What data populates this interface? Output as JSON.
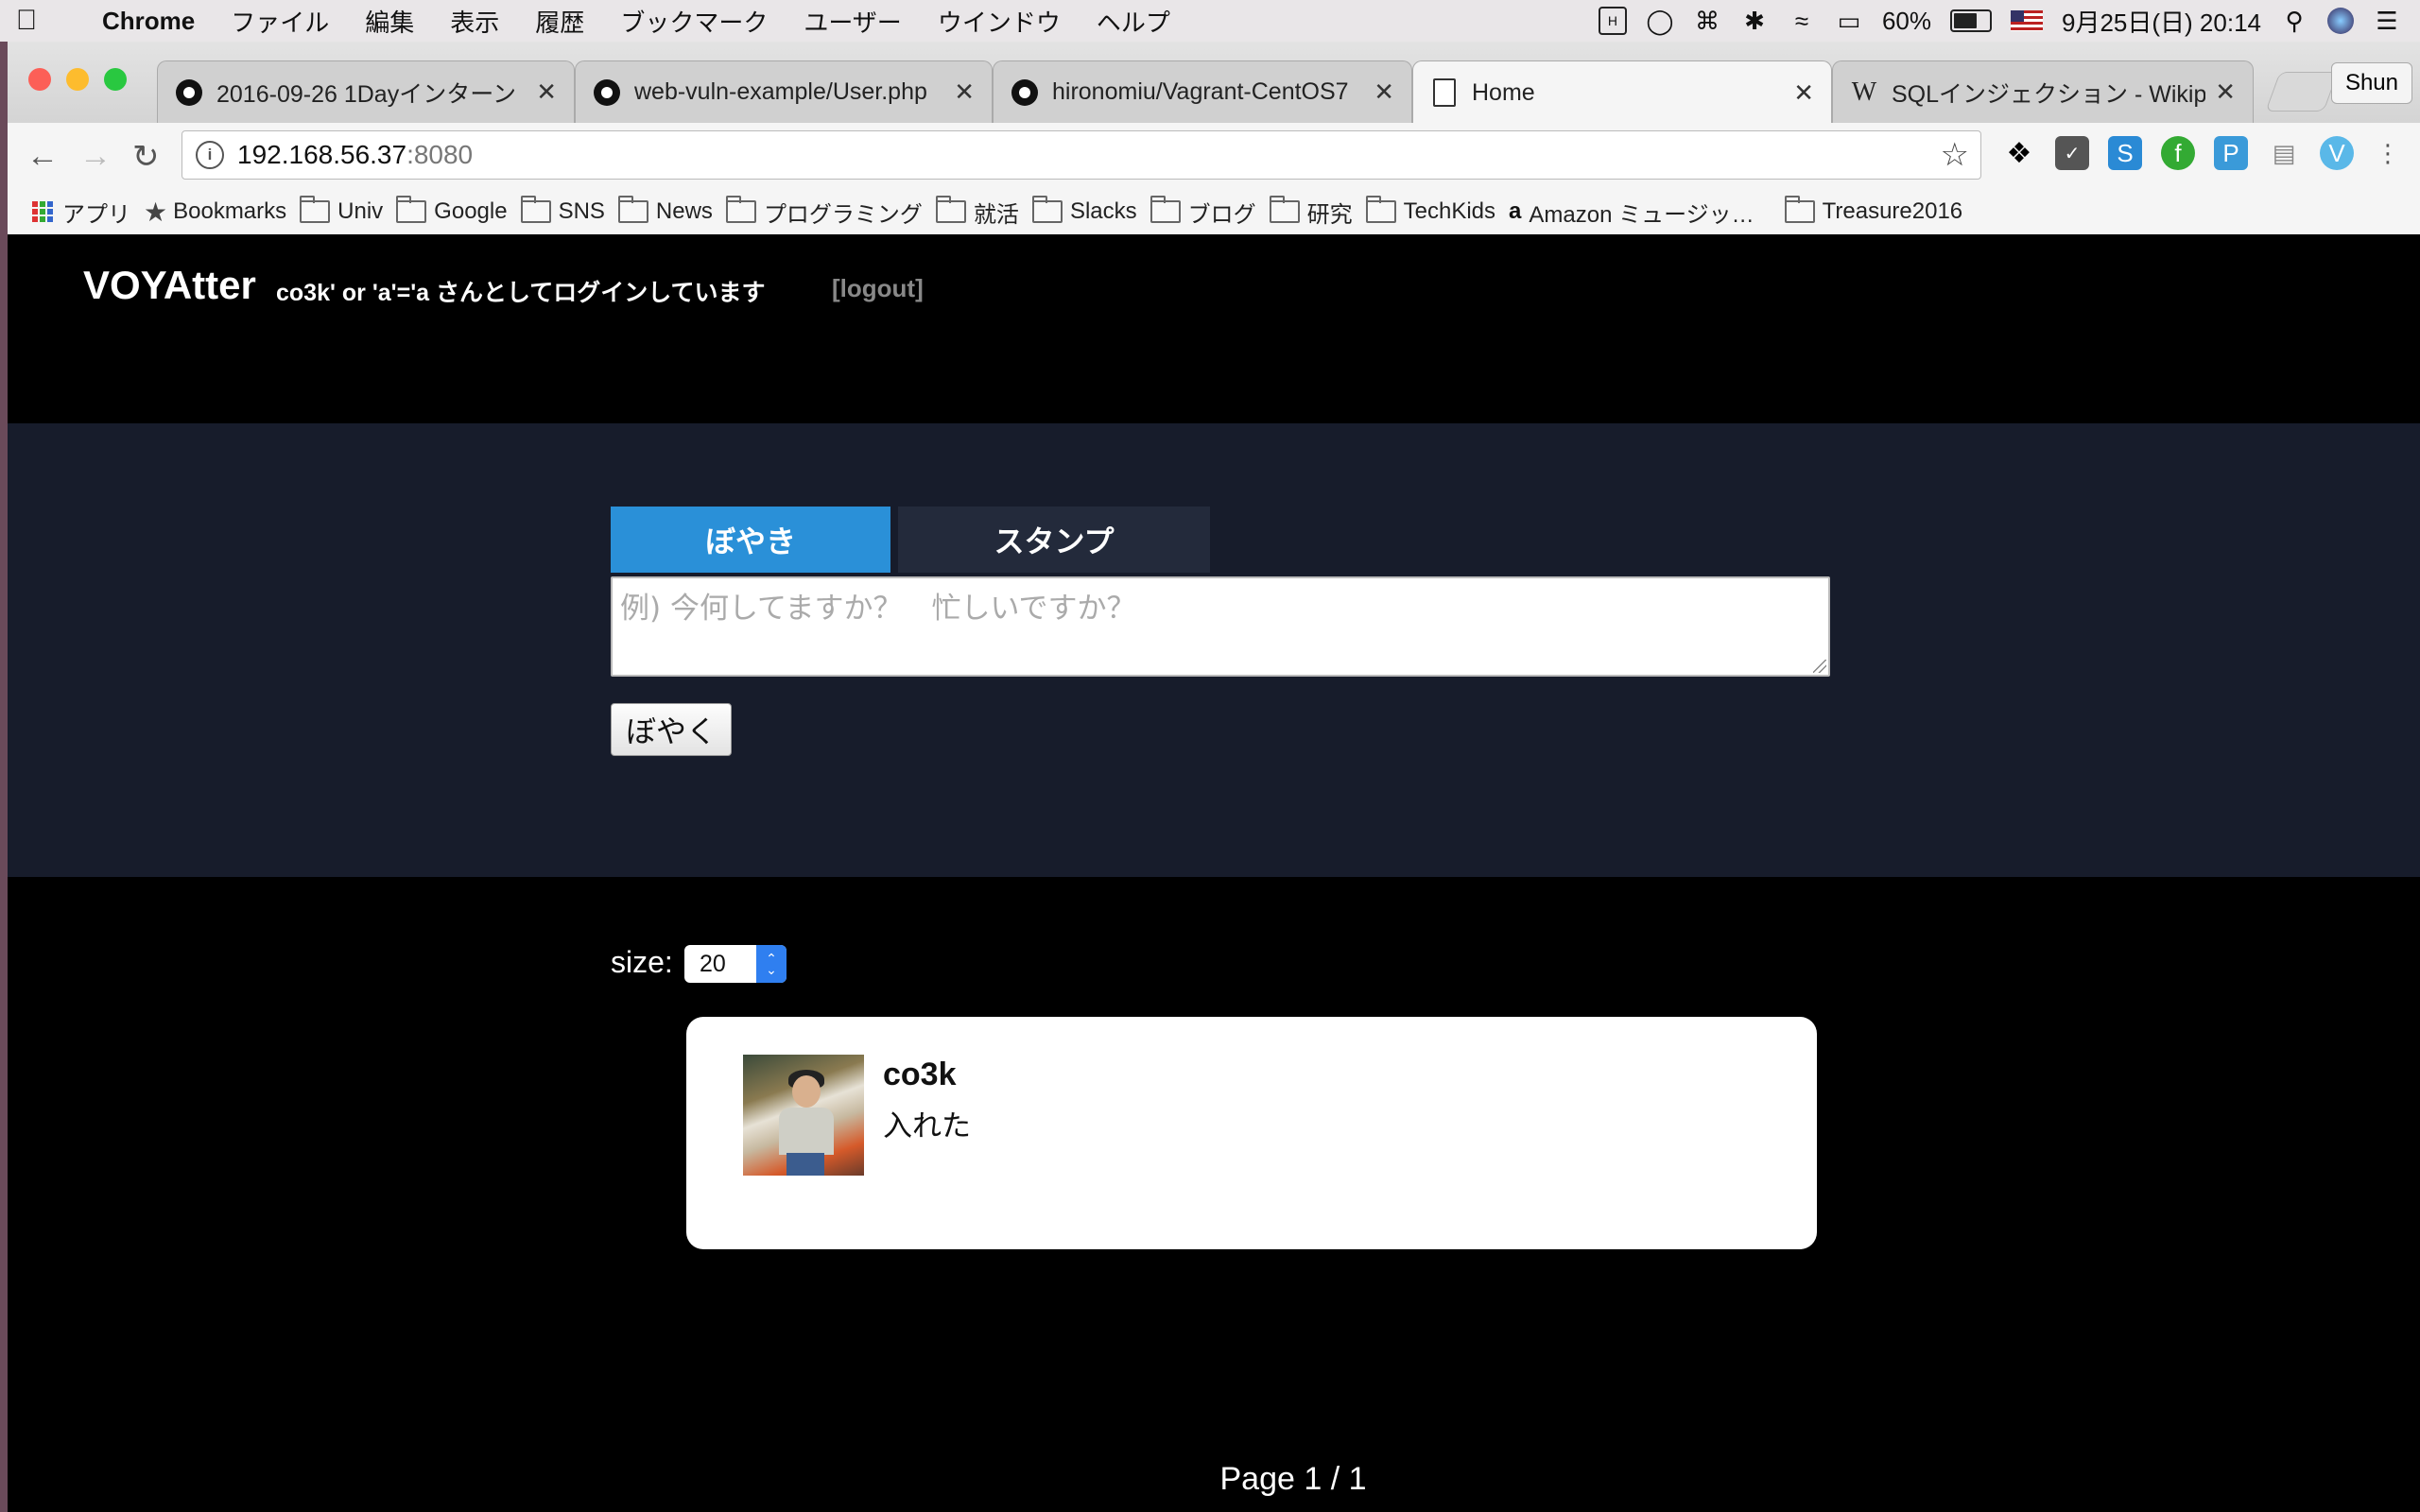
{
  "menubar": {
    "app_name": "Chrome",
    "menus": [
      "ファイル",
      "編集",
      "表示",
      "履歴",
      "ブックマーク",
      "ユーザー",
      "ウインドウ",
      "ヘルプ"
    ],
    "battery": "60%",
    "datetime": "9月25日(日)  20:14"
  },
  "tabs": [
    {
      "title": "2016-09-26 1Dayインターン",
      "icon": "github-icon"
    },
    {
      "title": "web-vuln-example/User.php",
      "icon": "github-icon"
    },
    {
      "title": "hironomiu/Vagrant-CentOS7",
      "icon": "github-icon"
    },
    {
      "title": "Home",
      "icon": "document-icon",
      "active": true
    },
    {
      "title": "SQLインジェクション - Wikipe",
      "icon": "wikipedia-icon"
    }
  ],
  "profile_name": "Shun",
  "address": {
    "host": "192.168.56.37",
    "port": ":8080"
  },
  "bookmarks": [
    {
      "label": "アプリ",
      "type": "apps"
    },
    {
      "label": "Bookmarks",
      "type": "star"
    },
    {
      "label": "Univ",
      "type": "folder"
    },
    {
      "label": "Google",
      "type": "folder"
    },
    {
      "label": "SNS",
      "type": "folder"
    },
    {
      "label": "News",
      "type": "folder"
    },
    {
      "label": "プログラミング",
      "type": "folder"
    },
    {
      "label": "就活",
      "type": "folder"
    },
    {
      "label": "Slacks",
      "type": "folder"
    },
    {
      "label": "ブログ",
      "type": "folder"
    },
    {
      "label": "研究",
      "type": "folder"
    },
    {
      "label": "TechKids",
      "type": "folder"
    },
    {
      "label": "Amazon ミュージッ…",
      "type": "amazon"
    },
    {
      "label": "Treasure2016",
      "type": "folder"
    }
  ],
  "site": {
    "logo": "VOYAtter",
    "login_message": "co3k' or 'a'='a さんとしてログインしています",
    "logout": "[logout]",
    "tab_boyaki": "ぼやき",
    "tab_stamp": "スタンプ",
    "textarea_placeholder": "例) 今何してますか？　忙しいですか？",
    "post_button": "ぼやく",
    "size_label": "size:",
    "size_value": "20",
    "pager": "Page 1 / 1"
  },
  "posts": [
    {
      "user": "co3k",
      "text": "入れた"
    }
  ]
}
